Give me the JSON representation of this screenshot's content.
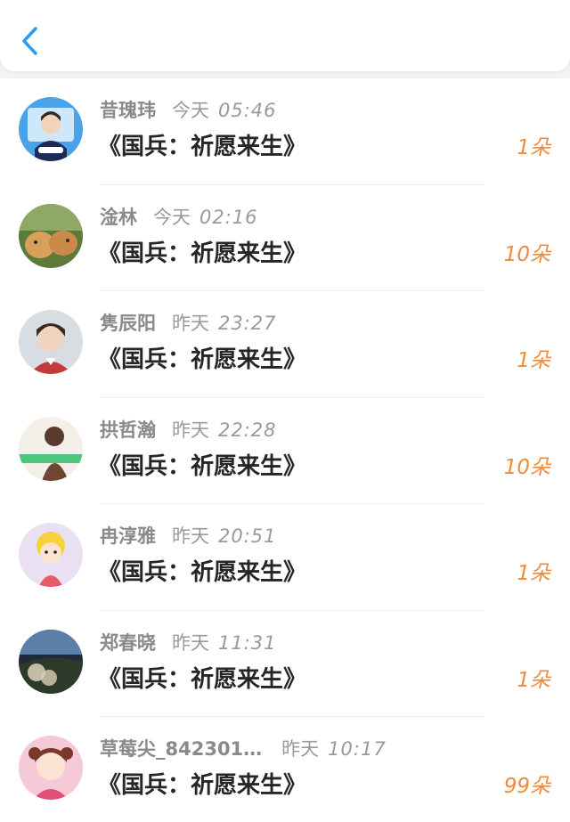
{
  "header": {
    "back_icon": "chevron-left-icon",
    "accent": "#2b9cf0"
  },
  "colors": {
    "quantity": "#f08a3c",
    "meta": "#9a9a9a",
    "title": "#262626"
  },
  "gifts": [
    {
      "name": "昔瑰玮",
      "day": "今天",
      "time": "05:46",
      "title": "《国兵：祈愿来生》",
      "qty": "1朵",
      "avatar": "avatar-anime-boy"
    },
    {
      "name": "淦林",
      "day": "今天",
      "time": "02:16",
      "title": "《国兵：祈愿来生》",
      "qty": "10朵",
      "avatar": "avatar-two-cats"
    },
    {
      "name": "隽辰阳",
      "day": "昨天",
      "time": "23:27",
      "title": "《国兵：祈愿来生》",
      "qty": "1朵",
      "avatar": "avatar-young-man"
    },
    {
      "name": "拱哲瀚",
      "day": "昨天",
      "time": "22:28",
      "title": "《国兵：祈愿来生》",
      "qty": "10朵",
      "avatar": "avatar-silhouette-girl"
    },
    {
      "name": "冉淳雅",
      "day": "昨天",
      "time": "20:51",
      "title": "《国兵：祈愿来生》",
      "qty": "1朵",
      "avatar": "avatar-cartoon-girl"
    },
    {
      "name": "郑春晓",
      "day": "昨天",
      "time": "11:31",
      "title": "《国兵：祈愿来生》",
      "qty": "1朵",
      "avatar": "avatar-flowers-landscape"
    },
    {
      "name": "草莓尖_842301…",
      "day": "昨天",
      "time": "10:17",
      "title": "《国兵：祈愿来生》",
      "qty": "99朵",
      "avatar": "avatar-pink-cartoon"
    }
  ]
}
